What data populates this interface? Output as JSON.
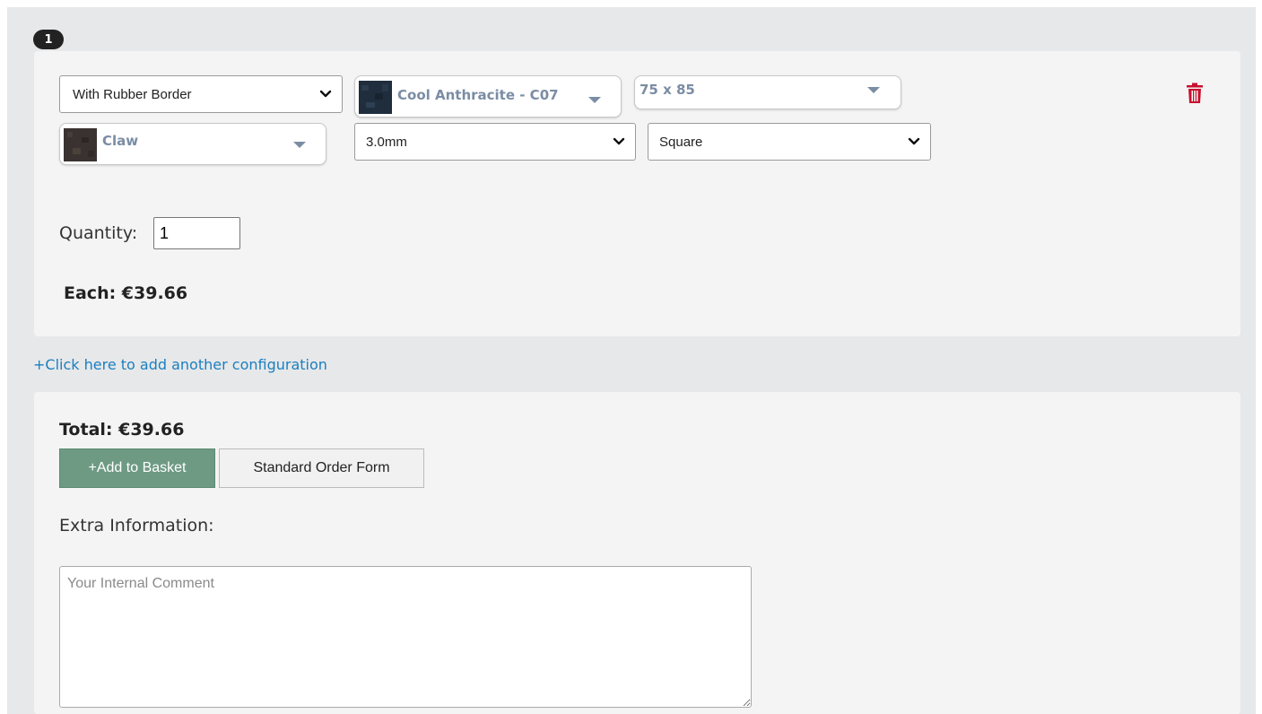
{
  "config": {
    "index_badge": "1",
    "border_select": {
      "value": "With Rubber Border",
      "options": [
        "With Rubber Border"
      ]
    },
    "color_dropdown": {
      "label": "Cool Anthracite - C07",
      "swatch": "dark-navy-textured"
    },
    "size_dropdown": {
      "label": "75 x 85"
    },
    "pattern_dropdown": {
      "label": "Claw",
      "swatch": "dark-brown-textured"
    },
    "thickness_select": {
      "value": "3.0mm",
      "options": [
        "3.0mm"
      ]
    },
    "shape_select": {
      "value": "Square",
      "options": [
        "Square"
      ]
    },
    "delete_icon": "trash-icon",
    "quantity_label": "Quantity:",
    "quantity_value": "1",
    "each_price": "Each: €39.66"
  },
  "add_config_link": "+Click here to add another configuration",
  "summary": {
    "total": "Total: €39.66",
    "add_to_basket_label": "+Add to Basket",
    "standard_order_form_label": "Standard Order Form",
    "extra_info_label": "Extra Information:",
    "comment_placeholder": "Your Internal Comment"
  },
  "colors": {
    "page_bg": "#e7e8e9",
    "panel_bg": "#f4f4f4",
    "link": "#1a7fc1",
    "add_button": "#6e9a84",
    "trash": "#c8102e",
    "dropdown_text": "#7b8da4"
  }
}
